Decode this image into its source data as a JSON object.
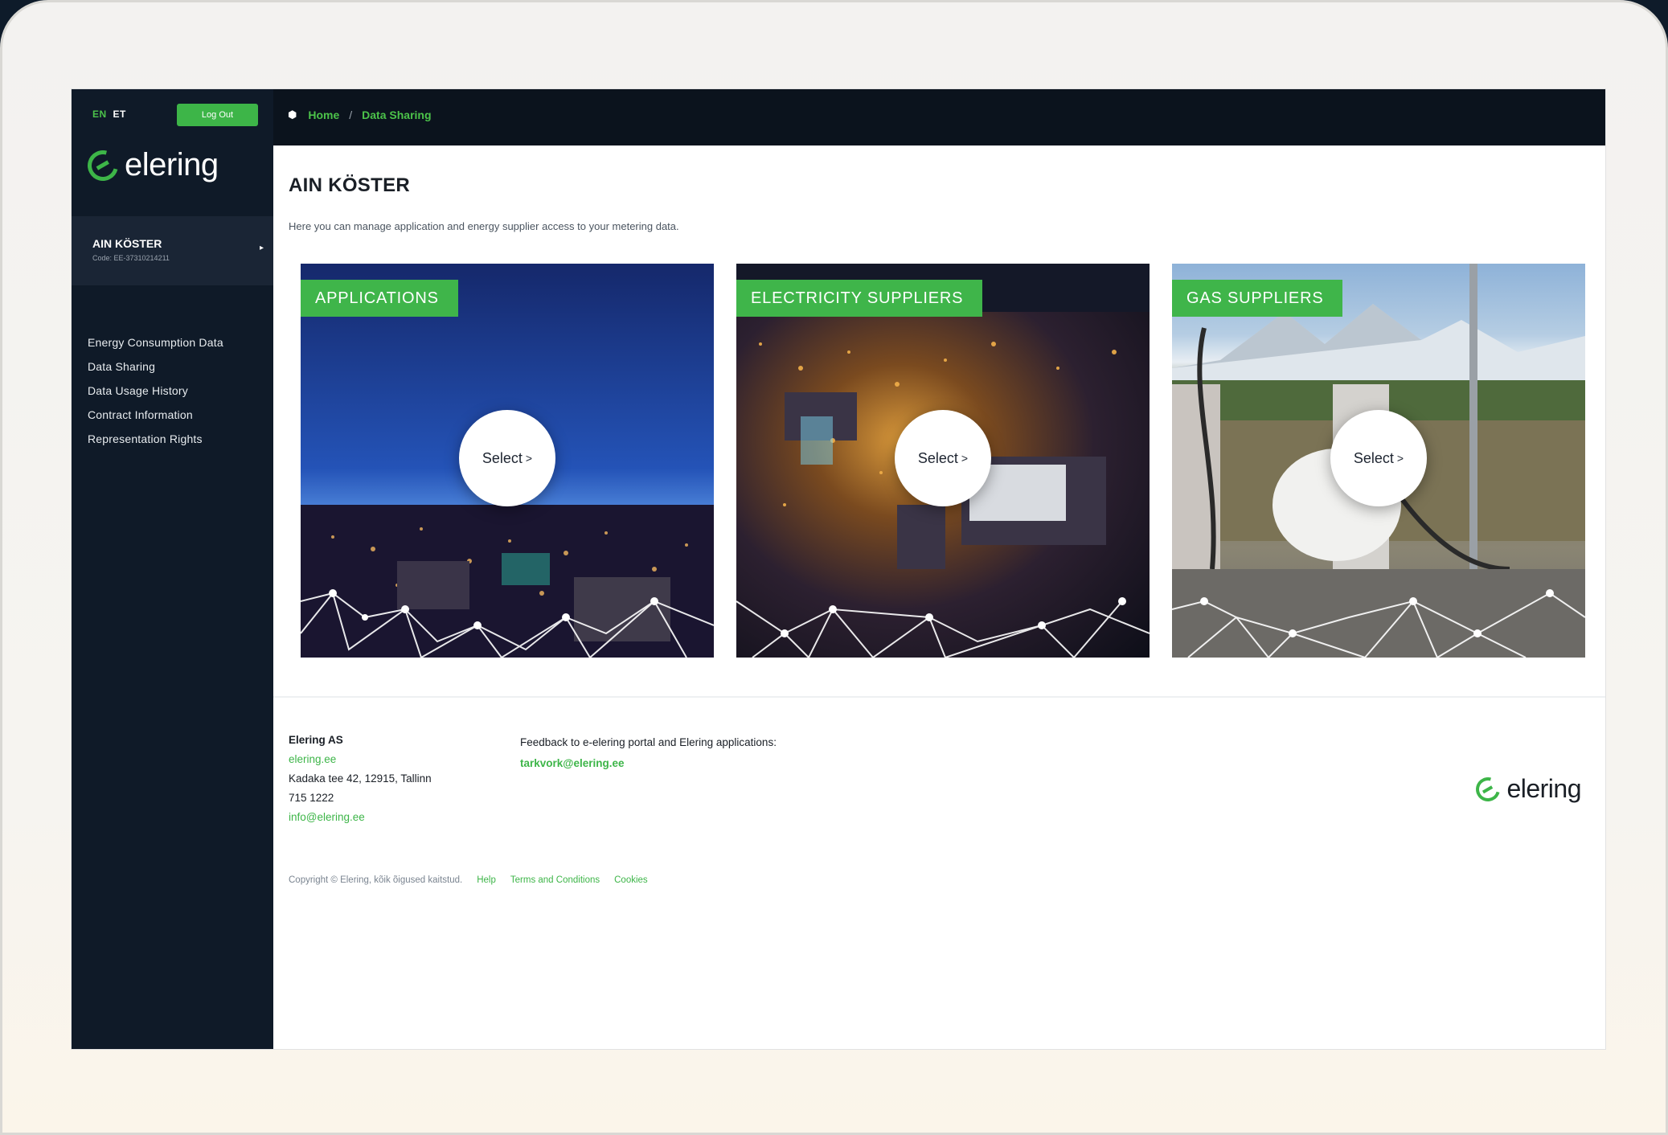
{
  "colors": {
    "accent": "#3db548",
    "sidebar": "#0f1a28",
    "topbar": "#0b131d"
  },
  "lang": {
    "active": "EN",
    "other": "ET"
  },
  "logout_label": "Log Out",
  "brand": "elering",
  "user": {
    "name": "AIN KÖSTER",
    "code": "Code: EE-37310214211"
  },
  "nav": {
    "items": [
      {
        "label": "Energy Consumption Data"
      },
      {
        "label": "Data Sharing"
      },
      {
        "label": "Data Usage History"
      },
      {
        "label": "Contract Information"
      },
      {
        "label": "Representation Rights"
      }
    ]
  },
  "breadcrumb": {
    "home": "Home",
    "sep": "/",
    "current": "Data Sharing"
  },
  "page": {
    "title": "AIN KÖSTER",
    "intro": "Here you can manage application and energy supplier access to your metering data."
  },
  "cards": [
    {
      "label": "APPLICATIONS",
      "select": "Select"
    },
    {
      "label": "ELECTRICITY SUPPLIERS",
      "select": "Select"
    },
    {
      "label": "GAS SUPPLIERS",
      "select": "Select"
    }
  ],
  "footer": {
    "company": "Elering AS",
    "website": "elering.ee",
    "address": "Kadaka tee 42, 12915, Tallinn",
    "phone": "715 1222",
    "email": "info@elering.ee",
    "feedback_text": "Feedback to e-elering portal and Elering applications:",
    "feedback_email": "tarkvork@elering.ee",
    "copyright": "Copyright © Elering, kõik õigused kaitstud.",
    "links": [
      "Help",
      "Terms and Conditions",
      "Cookies"
    ]
  }
}
